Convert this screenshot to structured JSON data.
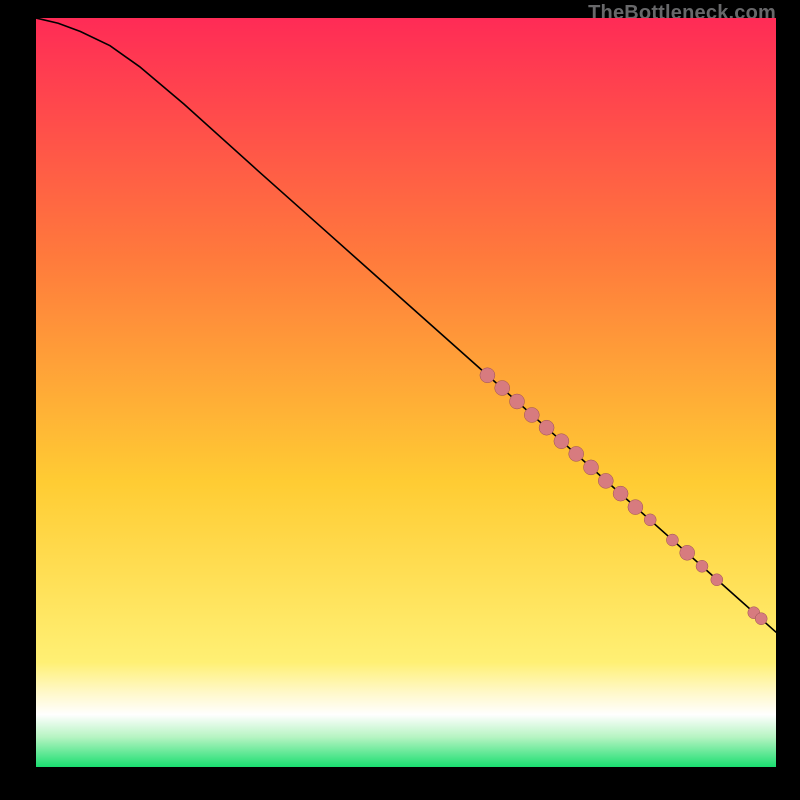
{
  "attribution": "TheBottleneck.com",
  "colors": {
    "bg_black": "#000000",
    "grad_top": "#ff2b56",
    "grad_upper_mid": "#ff7a3c",
    "grad_mid": "#ffcc33",
    "grad_pale_yellow": "#fff8c8",
    "grad_white": "#ffffff",
    "grad_lightgreen": "#b6f4c2",
    "grad_green": "#1ade70",
    "curve": "#000000",
    "marker_fill": "#d77b7f",
    "marker_stroke": "#9a4f53"
  },
  "chart_data": {
    "type": "line",
    "title": "",
    "xlabel": "",
    "ylabel": "",
    "xlim": [
      0,
      100
    ],
    "ylim": [
      0,
      100
    ],
    "curve": {
      "x": [
        0,
        3,
        6,
        10,
        14,
        20,
        30,
        40,
        50,
        60,
        70,
        75,
        80,
        85,
        90,
        95,
        100
      ],
      "y": [
        100,
        99.3,
        98.2,
        96.3,
        93.5,
        88.5,
        79.6,
        70.8,
        62.0,
        53.2,
        44.4,
        40.0,
        35.6,
        31.2,
        26.8,
        22.4,
        18.0
      ]
    },
    "markers": [
      {
        "x": 61,
        "y": 52.3,
        "r": 5
      },
      {
        "x": 63,
        "y": 50.6,
        "r": 5
      },
      {
        "x": 65,
        "y": 48.8,
        "r": 5
      },
      {
        "x": 67,
        "y": 47.0,
        "r": 5
      },
      {
        "x": 69,
        "y": 45.3,
        "r": 5
      },
      {
        "x": 71,
        "y": 43.5,
        "r": 5
      },
      {
        "x": 73,
        "y": 41.8,
        "r": 5
      },
      {
        "x": 75,
        "y": 40.0,
        "r": 5
      },
      {
        "x": 77,
        "y": 38.2,
        "r": 5
      },
      {
        "x": 79,
        "y": 36.5,
        "r": 5
      },
      {
        "x": 81,
        "y": 34.7,
        "r": 5
      },
      {
        "x": 83,
        "y": 33.0,
        "r": 4
      },
      {
        "x": 86,
        "y": 30.3,
        "r": 4
      },
      {
        "x": 88,
        "y": 28.6,
        "r": 5
      },
      {
        "x": 90,
        "y": 26.8,
        "r": 4
      },
      {
        "x": 92,
        "y": 25.0,
        "r": 4
      },
      {
        "x": 97,
        "y": 20.6,
        "r": 4
      },
      {
        "x": 98,
        "y": 19.8,
        "r": 4
      }
    ]
  }
}
